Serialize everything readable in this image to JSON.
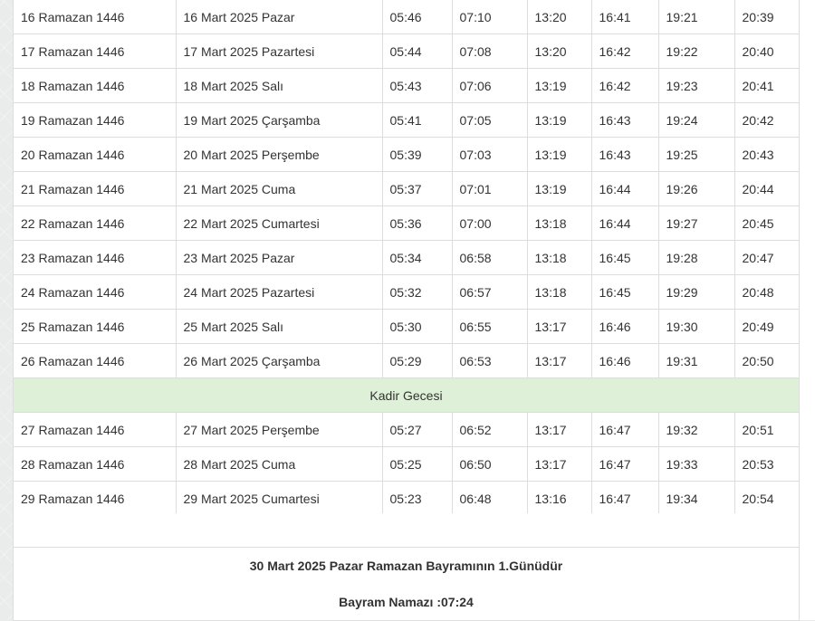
{
  "rows": [
    {
      "hijri": "16 Ramazan 1446",
      "date": "16 Mart 2025 Pazar",
      "t1": "05:46",
      "t2": "07:10",
      "t3": "13:20",
      "t4": "16:41",
      "t5": "19:21",
      "t6": "20:39"
    },
    {
      "hijri": "17 Ramazan 1446",
      "date": "17 Mart 2025 Pazartesi",
      "t1": "05:44",
      "t2": "07:08",
      "t3": "13:20",
      "t4": "16:42",
      "t5": "19:22",
      "t6": "20:40"
    },
    {
      "hijri": "18 Ramazan 1446",
      "date": "18 Mart 2025 Salı",
      "t1": "05:43",
      "t2": "07:06",
      "t3": "13:19",
      "t4": "16:42",
      "t5": "19:23",
      "t6": "20:41"
    },
    {
      "hijri": "19 Ramazan 1446",
      "date": "19 Mart 2025 Çarşamba",
      "t1": "05:41",
      "t2": "07:05",
      "t3": "13:19",
      "t4": "16:43",
      "t5": "19:24",
      "t6": "20:42"
    },
    {
      "hijri": "20 Ramazan 1446",
      "date": "20 Mart 2025 Perşembe",
      "t1": "05:39",
      "t2": "07:03",
      "t3": "13:19",
      "t4": "16:43",
      "t5": "19:25",
      "t6": "20:43"
    },
    {
      "hijri": "21 Ramazan 1446",
      "date": "21 Mart 2025 Cuma",
      "t1": "05:37",
      "t2": "07:01",
      "t3": "13:19",
      "t4": "16:44",
      "t5": "19:26",
      "t6": "20:44"
    },
    {
      "hijri": "22 Ramazan 1446",
      "date": "22 Mart 2025 Cumartesi",
      "t1": "05:36",
      "t2": "07:00",
      "t3": "13:18",
      "t4": "16:44",
      "t5": "19:27",
      "t6": "20:45"
    },
    {
      "hijri": "23 Ramazan 1446",
      "date": "23 Mart 2025 Pazar",
      "t1": "05:34",
      "t2": "06:58",
      "t3": "13:18",
      "t4": "16:45",
      "t5": "19:28",
      "t6": "20:47"
    },
    {
      "hijri": "24 Ramazan 1446",
      "date": "24 Mart 2025 Pazartesi",
      "t1": "05:32",
      "t2": "06:57",
      "t3": "13:18",
      "t4": "16:45",
      "t5": "19:29",
      "t6": "20:48"
    },
    {
      "hijri": "25 Ramazan 1446",
      "date": "25 Mart 2025 Salı",
      "t1": "05:30",
      "t2": "06:55",
      "t3": "13:17",
      "t4": "16:46",
      "t5": "19:30",
      "t6": "20:49"
    },
    {
      "hijri": "26 Ramazan 1446",
      "date": "26 Mart 2025 Çarşamba",
      "t1": "05:29",
      "t2": "06:53",
      "t3": "13:17",
      "t4": "16:46",
      "t5": "19:31",
      "t6": "20:50"
    },
    {
      "special": "Kadir Gecesi"
    },
    {
      "hijri": "27 Ramazan 1446",
      "date": "27 Mart 2025 Perşembe",
      "t1": "05:27",
      "t2": "06:52",
      "t3": "13:17",
      "t4": "16:47",
      "t5": "19:32",
      "t6": "20:51"
    },
    {
      "hijri": "28 Ramazan 1446",
      "date": "28 Mart 2025 Cuma",
      "t1": "05:25",
      "t2": "06:50",
      "t3": "13:17",
      "t4": "16:47",
      "t5": "19:33",
      "t6": "20:53"
    },
    {
      "hijri": "29 Ramazan 1446",
      "date": "29 Mart 2025 Cumartesi",
      "t1": "05:23",
      "t2": "06:48",
      "t3": "13:16",
      "t4": "16:47",
      "t5": "19:34",
      "t6": "20:54"
    }
  ],
  "footer": {
    "bayram_text": "30 Mart 2025 Pazar Ramazan Bayramının 1.Günüdür",
    "namaz_text": "Bayram Namazı :07:24"
  },
  "colors": {
    "special_row_bg": "#dff0d8",
    "border": "#dddddd"
  }
}
